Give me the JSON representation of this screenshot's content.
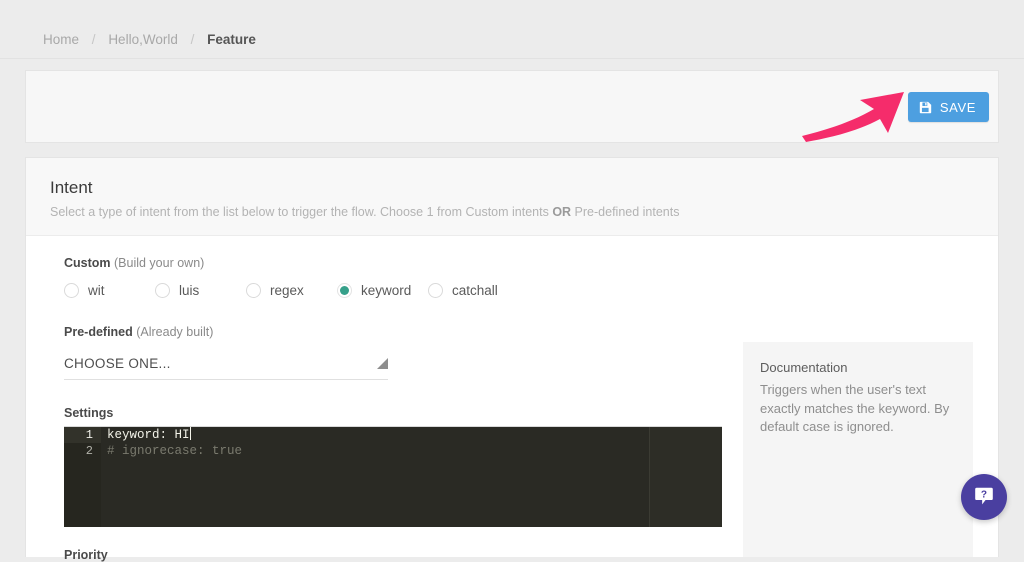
{
  "breadcrumb": {
    "items": [
      {
        "label": "Home",
        "current": false
      },
      {
        "label": "Hello,World",
        "current": false
      },
      {
        "label": "Feature",
        "current": true
      }
    ],
    "separator": "/"
  },
  "toolbar": {
    "save_label": "SAVE",
    "save_icon": "floppy-disk-save-icon",
    "save_color": "#4d9fe0"
  },
  "annotation": {
    "arrow_icon": "pink-arrow-pointing-to-save",
    "arrow_color": "#f52c6b"
  },
  "intent_card": {
    "title": "Intent",
    "subtitle_before": "Select a type of intent from the list below to trigger the flow. Choose 1 from Custom intents ",
    "subtitle_bold": "OR",
    "subtitle_after": " Pre-defined intents"
  },
  "form": {
    "custom": {
      "label_strong": "Custom",
      "label_note": " (Build your own)",
      "options": [
        {
          "label": "wit",
          "selected": false
        },
        {
          "label": "luis",
          "selected": false
        },
        {
          "label": "regex",
          "selected": false
        },
        {
          "label": "keyword",
          "selected": true
        },
        {
          "label": "catchall",
          "selected": false
        }
      ],
      "selected_value": "keyword",
      "selected_color": "#36a08a"
    },
    "predefined": {
      "label_strong": "Pre-defined",
      "label_note": " (Already built)",
      "select_value": "CHOOSE ONE...",
      "caret_icon": "dropdown-triangle-icon"
    },
    "settings": {
      "label": "Settings",
      "lines": [
        {
          "number": "1",
          "text": "keyword: HI",
          "comment": false,
          "active": true
        },
        {
          "number": "2",
          "text": "# ignorecase: true",
          "comment": true,
          "active": false
        }
      ]
    },
    "priority": {
      "label": "Priority"
    }
  },
  "documentation": {
    "title": "Documentation",
    "text": "Triggers when the user's text exactly matches the keyword. By default case is ignored."
  },
  "help": {
    "icon": "question-mark-chat-bubble-icon",
    "label": "?",
    "color": "#4a3fa0"
  }
}
